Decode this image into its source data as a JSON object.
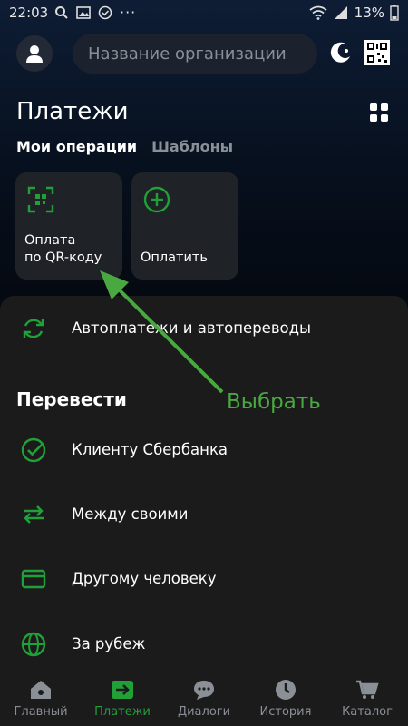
{
  "status_bar": {
    "time": "22:03",
    "battery": "13%"
  },
  "header": {
    "search_placeholder": "Название организации"
  },
  "page": {
    "title": "Платежи",
    "tabs": [
      {
        "label": "Мои операции",
        "active": true
      },
      {
        "label": "Шаблоны",
        "active": false
      }
    ]
  },
  "quick_cards": [
    {
      "label": "Оплата\nпо QR-коду",
      "icon": "qr-scan-icon"
    },
    {
      "label": "Оплатить",
      "icon": "plus-circle-icon"
    }
  ],
  "autopay": {
    "label": "Автоплатежи и автопереводы",
    "icon": "refresh-icon"
  },
  "transfer_section": {
    "title": "Перевести",
    "items": [
      {
        "label": "Клиенту Сбербанка",
        "icon": "check-circle-icon"
      },
      {
        "label": "Между своими",
        "icon": "arrows-swap-icon"
      },
      {
        "label": "Другому человеку",
        "icon": "card-icon"
      },
      {
        "label": "За рубеж",
        "icon": "globe-icon"
      }
    ]
  },
  "annotation": {
    "text": "Выбрать"
  },
  "bottom_nav": [
    {
      "label": "Главный",
      "icon": "home-icon",
      "active": false
    },
    {
      "label": "Платежи",
      "icon": "payments-icon",
      "active": true
    },
    {
      "label": "Диалоги",
      "icon": "chat-icon",
      "active": false
    },
    {
      "label": "История",
      "icon": "clock-icon",
      "active": false
    },
    {
      "label": "Каталог",
      "icon": "cart-icon",
      "active": false
    }
  ],
  "colors": {
    "accent": "#21a038",
    "annotation": "#49a83f",
    "background": "#1b1b1c"
  }
}
